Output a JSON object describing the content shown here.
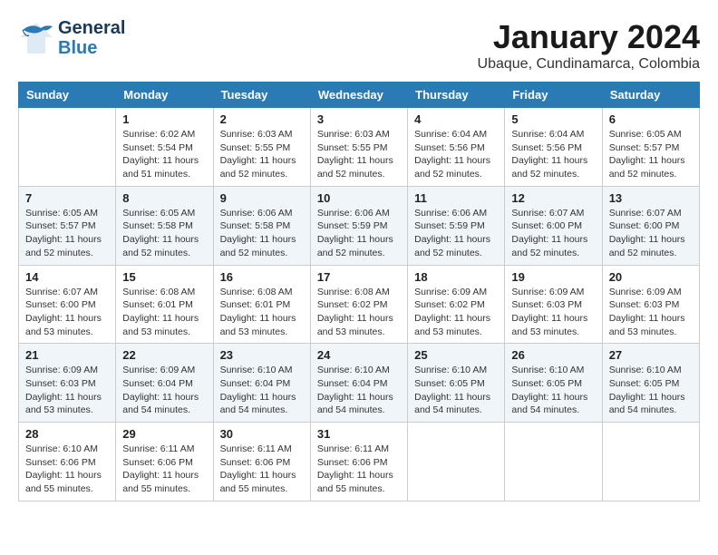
{
  "header": {
    "logo_line1": "General",
    "logo_line2": "Blue",
    "month": "January 2024",
    "location": "Ubaque, Cundinamarca, Colombia"
  },
  "days_of_week": [
    "Sunday",
    "Monday",
    "Tuesday",
    "Wednesday",
    "Thursday",
    "Friday",
    "Saturday"
  ],
  "weeks": [
    [
      {
        "day": "",
        "info": ""
      },
      {
        "day": "1",
        "info": "Sunrise: 6:02 AM\nSunset: 5:54 PM\nDaylight: 11 hours\nand 51 minutes."
      },
      {
        "day": "2",
        "info": "Sunrise: 6:03 AM\nSunset: 5:55 PM\nDaylight: 11 hours\nand 52 minutes."
      },
      {
        "day": "3",
        "info": "Sunrise: 6:03 AM\nSunset: 5:55 PM\nDaylight: 11 hours\nand 52 minutes."
      },
      {
        "day": "4",
        "info": "Sunrise: 6:04 AM\nSunset: 5:56 PM\nDaylight: 11 hours\nand 52 minutes."
      },
      {
        "day": "5",
        "info": "Sunrise: 6:04 AM\nSunset: 5:56 PM\nDaylight: 11 hours\nand 52 minutes."
      },
      {
        "day": "6",
        "info": "Sunrise: 6:05 AM\nSunset: 5:57 PM\nDaylight: 11 hours\nand 52 minutes."
      }
    ],
    [
      {
        "day": "7",
        "info": "Sunrise: 6:05 AM\nSunset: 5:57 PM\nDaylight: 11 hours\nand 52 minutes."
      },
      {
        "day": "8",
        "info": "Sunrise: 6:05 AM\nSunset: 5:58 PM\nDaylight: 11 hours\nand 52 minutes."
      },
      {
        "day": "9",
        "info": "Sunrise: 6:06 AM\nSunset: 5:58 PM\nDaylight: 11 hours\nand 52 minutes."
      },
      {
        "day": "10",
        "info": "Sunrise: 6:06 AM\nSunset: 5:59 PM\nDaylight: 11 hours\nand 52 minutes."
      },
      {
        "day": "11",
        "info": "Sunrise: 6:06 AM\nSunset: 5:59 PM\nDaylight: 11 hours\nand 52 minutes."
      },
      {
        "day": "12",
        "info": "Sunrise: 6:07 AM\nSunset: 6:00 PM\nDaylight: 11 hours\nand 52 minutes."
      },
      {
        "day": "13",
        "info": "Sunrise: 6:07 AM\nSunset: 6:00 PM\nDaylight: 11 hours\nand 52 minutes."
      }
    ],
    [
      {
        "day": "14",
        "info": "Sunrise: 6:07 AM\nSunset: 6:00 PM\nDaylight: 11 hours\nand 53 minutes."
      },
      {
        "day": "15",
        "info": "Sunrise: 6:08 AM\nSunset: 6:01 PM\nDaylight: 11 hours\nand 53 minutes."
      },
      {
        "day": "16",
        "info": "Sunrise: 6:08 AM\nSunset: 6:01 PM\nDaylight: 11 hours\nand 53 minutes."
      },
      {
        "day": "17",
        "info": "Sunrise: 6:08 AM\nSunset: 6:02 PM\nDaylight: 11 hours\nand 53 minutes."
      },
      {
        "day": "18",
        "info": "Sunrise: 6:09 AM\nSunset: 6:02 PM\nDaylight: 11 hours\nand 53 minutes."
      },
      {
        "day": "19",
        "info": "Sunrise: 6:09 AM\nSunset: 6:03 PM\nDaylight: 11 hours\nand 53 minutes."
      },
      {
        "day": "20",
        "info": "Sunrise: 6:09 AM\nSunset: 6:03 PM\nDaylight: 11 hours\nand 53 minutes."
      }
    ],
    [
      {
        "day": "21",
        "info": "Sunrise: 6:09 AM\nSunset: 6:03 PM\nDaylight: 11 hours\nand 53 minutes."
      },
      {
        "day": "22",
        "info": "Sunrise: 6:09 AM\nSunset: 6:04 PM\nDaylight: 11 hours\nand 54 minutes."
      },
      {
        "day": "23",
        "info": "Sunrise: 6:10 AM\nSunset: 6:04 PM\nDaylight: 11 hours\nand 54 minutes."
      },
      {
        "day": "24",
        "info": "Sunrise: 6:10 AM\nSunset: 6:04 PM\nDaylight: 11 hours\nand 54 minutes."
      },
      {
        "day": "25",
        "info": "Sunrise: 6:10 AM\nSunset: 6:05 PM\nDaylight: 11 hours\nand 54 minutes."
      },
      {
        "day": "26",
        "info": "Sunrise: 6:10 AM\nSunset: 6:05 PM\nDaylight: 11 hours\nand 54 minutes."
      },
      {
        "day": "27",
        "info": "Sunrise: 6:10 AM\nSunset: 6:05 PM\nDaylight: 11 hours\nand 54 minutes."
      }
    ],
    [
      {
        "day": "28",
        "info": "Sunrise: 6:10 AM\nSunset: 6:06 PM\nDaylight: 11 hours\nand 55 minutes."
      },
      {
        "day": "29",
        "info": "Sunrise: 6:11 AM\nSunset: 6:06 PM\nDaylight: 11 hours\nand 55 minutes."
      },
      {
        "day": "30",
        "info": "Sunrise: 6:11 AM\nSunset: 6:06 PM\nDaylight: 11 hours\nand 55 minutes."
      },
      {
        "day": "31",
        "info": "Sunrise: 6:11 AM\nSunset: 6:06 PM\nDaylight: 11 hours\nand 55 minutes."
      },
      {
        "day": "",
        "info": ""
      },
      {
        "day": "",
        "info": ""
      },
      {
        "day": "",
        "info": ""
      }
    ]
  ]
}
